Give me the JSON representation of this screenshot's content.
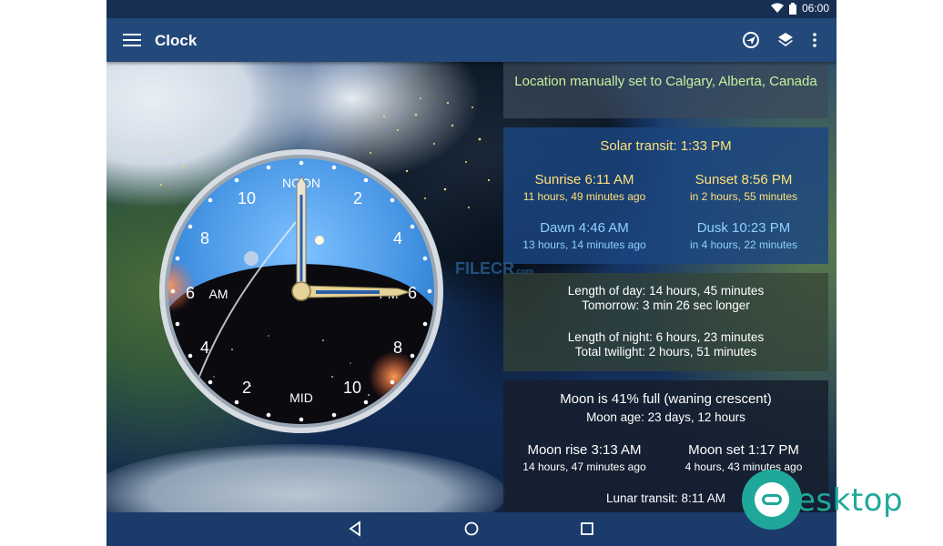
{
  "status_bar": {
    "time": "06:00"
  },
  "app_bar": {
    "title": "Clock",
    "actions": [
      "navigation-icon",
      "layers-icon",
      "more-vert-icon"
    ]
  },
  "clock": {
    "top_label": "NOON",
    "bottom_label": "MID",
    "left_label": "AM",
    "right_label": "PM",
    "hour_numbers": [
      "2",
      "4",
      "6",
      "8",
      "10",
      "2",
      "4",
      "6",
      "8",
      "10"
    ]
  },
  "location": {
    "text": "Location manually set to Calgary, Alberta, Canada"
  },
  "sun": {
    "solar_transit": "Solar transit: 1:33 PM",
    "sunrise": {
      "label": "Sunrise 6:11 AM",
      "detail": "11 hours, 49 minutes ago"
    },
    "sunset": {
      "label": "Sunset 8:56 PM",
      "detail": "in 2 hours, 55 minutes"
    },
    "dawn": {
      "label": "Dawn 4:46 AM",
      "detail": "13 hours, 14 minutes ago"
    },
    "dusk": {
      "label": "Dusk 10:23 PM",
      "detail": "in 4 hours, 22 minutes"
    }
  },
  "daylength": {
    "day": "Length of day: 14 hours, 45 minutes",
    "tomorrow": "Tomorrow: 3 min 26 sec longer",
    "night": "Length of night: 6 hours, 23 minutes",
    "twilight": "Total twilight: 2 hours, 51 minutes"
  },
  "moon": {
    "phase": "Moon is 41% full (waning crescent)",
    "age": "Moon age: 23 days, 12 hours",
    "rise": {
      "label": "Moon rise 3:13 AM",
      "detail": "14 hours, 47 minutes ago"
    },
    "set": {
      "label": "Moon set 1:17 PM",
      "detail": "4 hours, 43 minutes ago"
    },
    "transit": "Lunar transit: 8:11 AM"
  },
  "nav": [
    "back-icon",
    "home-icon",
    "recents-icon"
  ],
  "watermarks": {
    "filecr": "FILECR",
    "filecr_sub": ".com",
    "brand": "esktop"
  },
  "colors": {
    "appbar": "#23487a",
    "statusbar": "#172f52",
    "accent_yellow": "#ffe07a",
    "accent_blue": "#8fd0ff",
    "location_green": "#c6f09c"
  }
}
